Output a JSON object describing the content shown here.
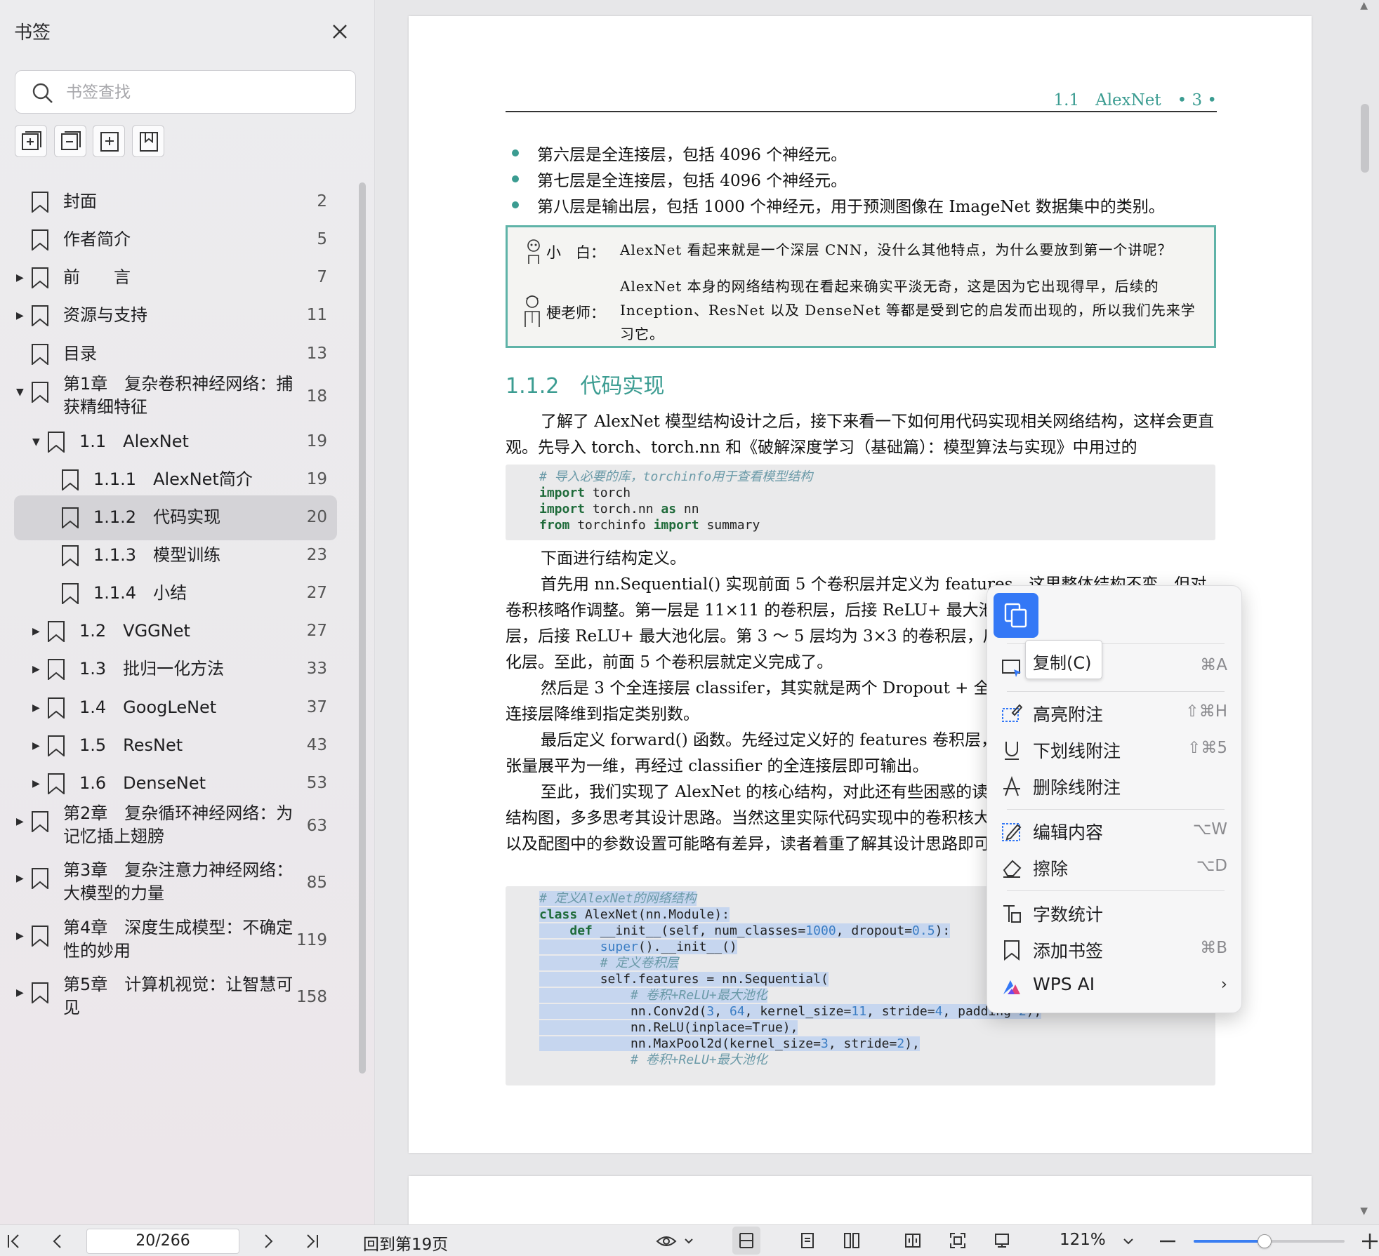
{
  "sidebar": {
    "title": "书签",
    "search_placeholder": "书签查找",
    "items": [
      {
        "label": "封面",
        "page": "2",
        "arrow": ""
      },
      {
        "label": "作者简介",
        "page": "5",
        "arrow": ""
      },
      {
        "label": "前　　言",
        "page": "7",
        "arrow": "▶"
      },
      {
        "label": "资源与支持",
        "page": "11",
        "arrow": "▶"
      },
      {
        "label": "目录",
        "page": "13",
        "arrow": ""
      },
      {
        "label": "第1章　复杂卷积神经网络：捕获精细特征",
        "page": "18",
        "arrow": "▼"
      },
      {
        "label": "1.1　AlexNet",
        "page": "19",
        "arrow": "▼"
      },
      {
        "label": "1.1.1　AlexNet简介",
        "page": "19",
        "arrow": ""
      },
      {
        "label": "1.1.2　代码实现",
        "page": "20",
        "arrow": "",
        "selected": true
      },
      {
        "label": "1.1.3　模型训练",
        "page": "23",
        "arrow": ""
      },
      {
        "label": "1.1.4　小结",
        "page": "27",
        "arrow": ""
      },
      {
        "label": "1.2　VGGNet",
        "page": "27",
        "arrow": "▶"
      },
      {
        "label": "1.3　批归一化方法",
        "page": "33",
        "arrow": "▶"
      },
      {
        "label": "1.4　GoogLeNet",
        "page": "37",
        "arrow": "▶"
      },
      {
        "label": "1.5　ResNet",
        "page": "43",
        "arrow": "▶"
      },
      {
        "label": "1.6　DenseNet",
        "page": "53",
        "arrow": "▶"
      },
      {
        "label": "第2章　复杂循环神经网络：为记忆插上翅膀",
        "page": "63",
        "arrow": "▶"
      },
      {
        "label": "第3章　复杂注意力神经网络：大模型的力量",
        "page": "85",
        "arrow": "▶"
      },
      {
        "label": "第4章　深度生成模型：不确定性的妙用",
        "page": "119",
        "arrow": "▶"
      },
      {
        "label": "第5章　计算机视觉：让智慧可见",
        "page": "158",
        "arrow": "▶"
      }
    ]
  },
  "page": {
    "running_head": "1.1　AlexNet　• 3 •",
    "bullets": [
      "第六层是全连接层，包括 4096 个神经元。",
      "第七层是全连接层，包括 4096 个神经元。",
      "第八层是输出层，包括 1000 个神经元，用于预测图像在 ImageNet 数据集中的类别。"
    ],
    "dialog": {
      "speaker1": "小　白：",
      "line1": "AlexNet 看起来就是一个深层 CNN，没什么其他特点，为什么要放到第一个讲呢？",
      "speaker2": "梗老师：",
      "line2a": "AlexNet 本身的网络结构现在看起来确实平淡无奇，这是因为它出现得早，后续的",
      "line2b": "Inception、ResNet 以及 DenseNet 等都是受到它的启发而出现的，所以我们先来学",
      "line2c": "习它。"
    },
    "section_title": "1.1.2　代码实现",
    "para1": "了解了 AlexNet 模型结构设计之后，接下来看一下如何用代码实现相关网络结构，这样会更直观。先导入 torch、torch.nn 和《破解深度学习（基础篇）：模型算法与实现》中用过的 torchinfo。",
    "code1": [
      "# 导入必要的库，torchinfo用于查看模型结构",
      "import torch",
      "import torch.nn as nn",
      "from torchinfo import summary"
    ],
    "para2": "下面进行结构定义。",
    "para3": "首先用 nn.Sequential() 实现前面 5 个卷积层并定义为 features，这里整体结构不变，但对卷积核略作调整。第一层是 11×11 的卷积层，后接 ReLU+ 最大池化层。第二层是 5×5 的卷积层，后接 ReLU+ 最大池化层。第 3 ～ 5 层均为 3×3 的卷积层，后接 ReLU，第 5 层后接最大池化层。至此，前面 5 个卷积层就定义完成了。",
    "para4": "然后是 3 个全连接层 classifer，其实就是两个 Dropout + 全连接层 + ReLU，最后一个全连接层降维到指定类别数。",
    "para5": "最后定义 forward() 函数。先经过定义好的 features 卷积层，然后经过 flatten 函数将特征张量展平为一维，再经过 classifier 的全连接层即可输出。",
    "para6": "至此，我们实现了 AlexNet 的核心结构，对此还有些困惑的读者可以对照着前面的 AlexNet 结构图，多多思考其设计思路。当然这里实际代码实现中的卷积核大小等参数与 AlexNet 原始论文以及配图中的参数设置可能略有差异，读者着重了解其设计思路即可，具体参数后面会再单独说明。",
    "code2": [
      "# 定义AlexNet的网络结构",
      "class AlexNet(nn.Module):",
      "    def __init__(self, num_classes=1000, dropout=0.5):",
      "        super().__init__()",
      "        # 定义卷积层",
      "        self.features = nn.Sequential(",
      "            # 卷积+ReLU+最大池化",
      "            nn.Conv2d(3, 64, kernel_size=11, stride=4, padding=2),",
      "            nn.ReLU(inplace=True),",
      "            nn.MaxPool2d(kernel_size=3, stride=2),",
      "            # 卷积+ReLU+最大池化"
    ]
  },
  "context_menu": {
    "tooltip": "复制(C)",
    "items": [
      {
        "label": "",
        "shortcut": "⌘A",
        "icon": "select-icon"
      },
      {
        "label": "高亮附注",
        "shortcut": "⇧⌘H",
        "icon": "highlight-note-icon"
      },
      {
        "label": "下划线附注",
        "shortcut": "⇧⌘5",
        "icon": "underline-icon"
      },
      {
        "label": "删除线附注",
        "shortcut": "",
        "icon": "strikethrough-icon"
      },
      {
        "label": "编辑内容",
        "shortcut": "⌥W",
        "icon": "edit-icon"
      },
      {
        "label": "擦除",
        "shortcut": "⌥D",
        "icon": "eraser-icon"
      },
      {
        "label": "字数统计",
        "shortcut": "",
        "icon": "word-count-icon"
      },
      {
        "label": "添加书签",
        "shortcut": "⌘B",
        "icon": "bookmark-icon"
      },
      {
        "label": "WPS AI",
        "shortcut": "›",
        "icon": "wps-ai-icon"
      }
    ]
  },
  "statusbar": {
    "page_input": "20/266",
    "back_to": "回到第19页",
    "zoom": "121%",
    "zoom_fraction": 0.47
  },
  "colors": {
    "accent": "#3b9c91",
    "selection": "#c6d6ef",
    "menu_accent": "#3478f6"
  }
}
